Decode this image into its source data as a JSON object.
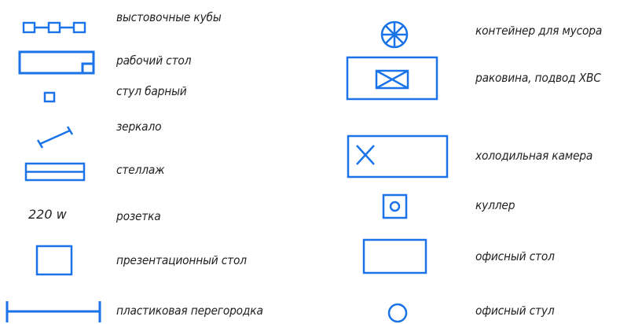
{
  "colors": {
    "symbol": "#1a73e8",
    "text": "#222222",
    "background": "#ffffff"
  },
  "legend": {
    "left": [
      {
        "icon": "exhibition-cubes-icon",
        "label": "выстовочные кубы"
      },
      {
        "icon": "work-desk-icon",
        "label": "рабочий стол"
      },
      {
        "icon": "bar-stool-icon",
        "label": "стул барный"
      },
      {
        "icon": "mirror-icon",
        "label": "зеркало"
      },
      {
        "icon": "shelving-icon",
        "label": "стеллаж"
      },
      {
        "icon": "socket-voltage",
        "label": "розетка",
        "symbol_text": "220 w"
      },
      {
        "icon": "presentation-table-icon",
        "label": "презентационный стол"
      },
      {
        "icon": "plastic-partition-icon",
        "label": "пластиковая перегородка"
      }
    ],
    "right": [
      {
        "icon": "trash-container-icon",
        "label": "контейнер для мусора"
      },
      {
        "icon": "sink-icon",
        "label": "раковина, подвод ХВС"
      },
      {
        "icon": "cold-room-icon",
        "label": "холодильная камера"
      },
      {
        "icon": "water-cooler-icon",
        "label": "куллер"
      },
      {
        "icon": "office-desk-icon",
        "label": "офисный стол"
      },
      {
        "icon": "office-chair-icon",
        "label": "офисный стул"
      }
    ]
  }
}
